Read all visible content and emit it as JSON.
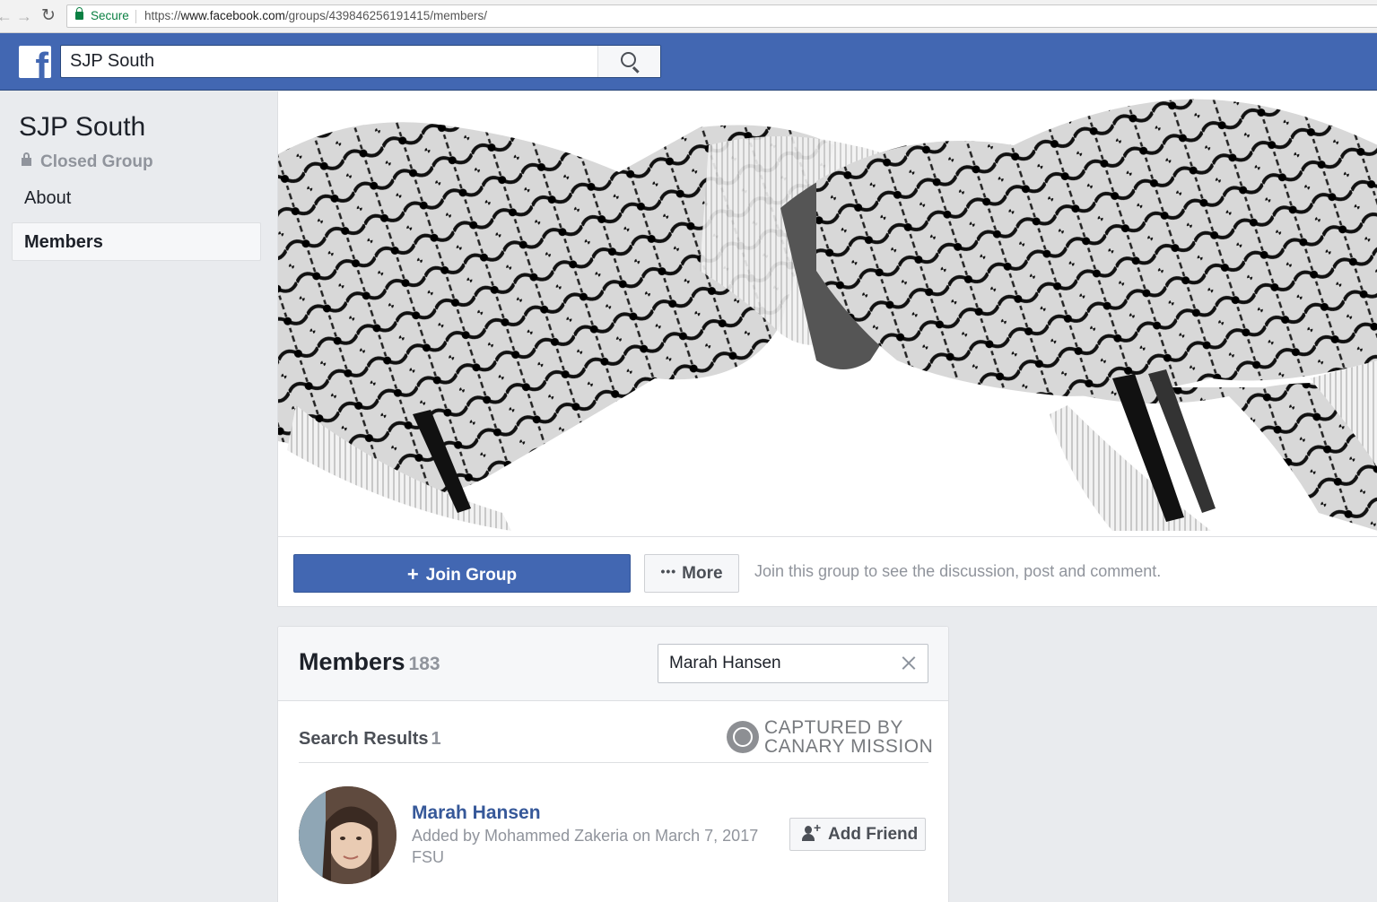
{
  "browser": {
    "secure_label": "Secure",
    "url_prefix": "https://",
    "url_host": "www.facebook.com",
    "url_path": "/groups/439846256191415/members/"
  },
  "fb_header": {
    "search_value": "SJP South"
  },
  "sidebar": {
    "group_name": "SJP South",
    "privacy": "Closed Group",
    "items": [
      {
        "label": "About"
      },
      {
        "label": "Members"
      }
    ]
  },
  "actions": {
    "join_label": "Join Group",
    "more_label": "More",
    "hint": "Join this group to see the discussion, post and comment."
  },
  "members": {
    "title": "Members",
    "count": "183",
    "search_value": "Marah Hansen",
    "results_label": "Search Results",
    "results_count": "1",
    "watermark_line1": "CAPTURED BY",
    "watermark_line2": "CANARY MISSION",
    "list": [
      {
        "name": "Marah Hansen",
        "added": "Added by Mohammed Zakeria on March 7, 2017",
        "school": "FSU",
        "add_friend_label": "Add Friend"
      }
    ]
  },
  "colors": {
    "fb_blue": "#4267b2",
    "link_blue": "#365899",
    "muted_gray": "#90949c",
    "secure_green": "#0b8043"
  },
  "icons": [
    "back-arrow-icon",
    "forward-arrow-icon",
    "reload-icon",
    "lock-icon",
    "facebook-logo-icon",
    "search-icon",
    "plus-icon",
    "more-dots-icon",
    "clear-icon",
    "canary-mission-badge-icon",
    "add-friend-icon"
  ]
}
